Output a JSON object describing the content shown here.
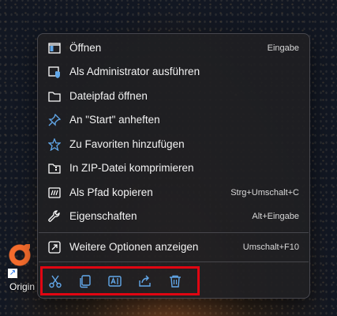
{
  "desktop": {
    "icon_label": "Origin"
  },
  "context_menu": {
    "items": [
      {
        "label": "Öffnen",
        "shortcut": "Eingabe",
        "icon": "open-window-icon"
      },
      {
        "label": "Als Administrator ausführen",
        "shortcut": "",
        "icon": "shield-admin-icon"
      },
      {
        "label": "Dateipfad öffnen",
        "shortcut": "",
        "icon": "folder-icon"
      },
      {
        "label": "An \"Start\" anheften",
        "shortcut": "",
        "icon": "pin-icon"
      },
      {
        "label": "Zu Favoriten hinzufügen",
        "shortcut": "",
        "icon": "star-icon"
      },
      {
        "label": "In ZIP-Datei komprimieren",
        "shortcut": "",
        "icon": "zip-folder-icon"
      },
      {
        "label": "Als Pfad kopieren",
        "shortcut": "Strg+Umschalt+C",
        "icon": "copy-path-icon"
      },
      {
        "label": "Eigenschaften",
        "shortcut": "Alt+Eingabe",
        "icon": "wrench-icon"
      },
      {
        "label": "Weitere Optionen anzeigen",
        "shortcut": "Umschalt+F10",
        "icon": "more-options-icon"
      }
    ],
    "toolbar": [
      {
        "icon": "cut-icon"
      },
      {
        "icon": "copy-icon"
      },
      {
        "icon": "rename-icon"
      },
      {
        "icon": "share-icon"
      },
      {
        "icon": "delete-icon"
      }
    ],
    "highlight_color": "#e00612",
    "accent_color": "#62a8ea"
  }
}
